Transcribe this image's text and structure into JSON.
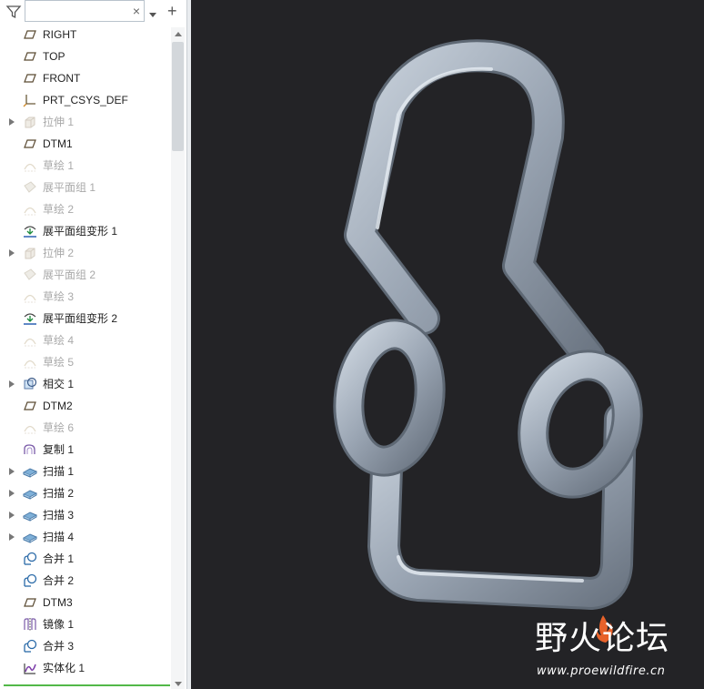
{
  "search": {
    "value": "",
    "placeholder": "",
    "clear_glyph": "×"
  },
  "toolbar": {
    "filter_icon": "filter-icon",
    "dropdown_icon": "chevron-down-icon",
    "add_glyph": "+"
  },
  "tree_items": [
    {
      "label": "RIGHT",
      "icon": "datum-plane-icon",
      "dim": false,
      "expandable": false
    },
    {
      "label": "TOP",
      "icon": "datum-plane-icon",
      "dim": false,
      "expandable": false
    },
    {
      "label": "FRONT",
      "icon": "datum-plane-icon",
      "dim": false,
      "expandable": false
    },
    {
      "label": "PRT_CSYS_DEF",
      "icon": "csys-icon",
      "dim": false,
      "expandable": false
    },
    {
      "label": "拉伸 1",
      "icon": "extrude-icon",
      "dim": true,
      "expandable": true
    },
    {
      "label": "DTM1",
      "icon": "datum-plane-icon",
      "dim": false,
      "expandable": false
    },
    {
      "label": "草绘 1",
      "icon": "sketch-icon",
      "dim": true,
      "expandable": false
    },
    {
      "label": "展平面组 1",
      "icon": "flatten-quilt-icon",
      "dim": true,
      "expandable": false
    },
    {
      "label": "草绘 2",
      "icon": "sketch-icon",
      "dim": true,
      "expandable": false
    },
    {
      "label": "展平面组变形 1",
      "icon": "flatten-deform-icon",
      "dim": false,
      "expandable": false
    },
    {
      "label": "拉伸 2",
      "icon": "extrude-icon",
      "dim": true,
      "expandable": true
    },
    {
      "label": "展平面组 2",
      "icon": "flatten-quilt-icon",
      "dim": true,
      "expandable": false
    },
    {
      "label": "草绘 3",
      "icon": "sketch-icon",
      "dim": true,
      "expandable": false
    },
    {
      "label": "展平面组变形 2",
      "icon": "flatten-deform-icon",
      "dim": false,
      "expandable": false
    },
    {
      "label": "草绘 4",
      "icon": "sketch-icon",
      "dim": true,
      "expandable": false
    },
    {
      "label": "草绘 5",
      "icon": "sketch-icon",
      "dim": true,
      "expandable": false
    },
    {
      "label": "相交 1",
      "icon": "intersect-icon",
      "dim": false,
      "expandable": true
    },
    {
      "label": "DTM2",
      "icon": "datum-plane-icon",
      "dim": false,
      "expandable": false
    },
    {
      "label": "草绘 6",
      "icon": "sketch-icon",
      "dim": true,
      "expandable": false
    },
    {
      "label": "复制 1",
      "icon": "copy-icon",
      "dim": false,
      "expandable": false
    },
    {
      "label": "扫描 1",
      "icon": "sweep-icon",
      "dim": false,
      "expandable": true
    },
    {
      "label": "扫描 2",
      "icon": "sweep-icon",
      "dim": false,
      "expandable": true
    },
    {
      "label": "扫描 3",
      "icon": "sweep-icon",
      "dim": false,
      "expandable": true
    },
    {
      "label": "扫描 4",
      "icon": "sweep-icon",
      "dim": false,
      "expandable": true
    },
    {
      "label": "合并 1",
      "icon": "merge-icon",
      "dim": false,
      "expandable": false
    },
    {
      "label": "合并 2",
      "icon": "merge-icon",
      "dim": false,
      "expandable": false
    },
    {
      "label": "DTM3",
      "icon": "datum-plane-icon",
      "dim": false,
      "expandable": false
    },
    {
      "label": "镜像 1",
      "icon": "mirror-icon",
      "dim": false,
      "expandable": false
    },
    {
      "label": "合并 3",
      "icon": "merge-icon",
      "dim": false,
      "expandable": false
    },
    {
      "label": "实体化 1",
      "icon": "solidify-icon",
      "dim": false,
      "expandable": false
    }
  ],
  "colors": {
    "viewport_bg": "#232326",
    "model_color": "#9aa5b3",
    "accent_green": "#52b848",
    "watermark_flame": "#e8622a"
  },
  "watermark": {
    "title": "野火论坛",
    "url": "www.proewildfire.cn"
  }
}
